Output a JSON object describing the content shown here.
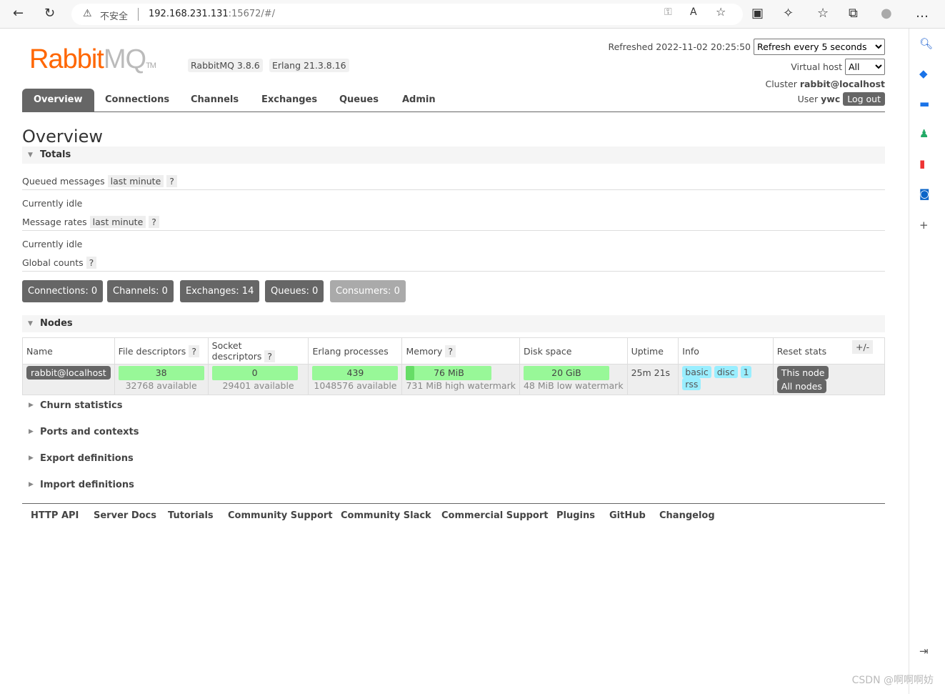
{
  "browser": {
    "insecure_label": "不安全",
    "url_host": "192.168.231.131",
    "url_rest": ":15672/#/"
  },
  "header": {
    "logo_text": "Rabbit",
    "logo_mq": "MQ",
    "logo_tm": "TM",
    "rabbitmq_version": "RabbitMQ 3.8.6",
    "erlang_version": "Erlang 21.3.8.16",
    "refreshed": "Refreshed 2022-11-02 20:25:50",
    "refresh_select": "Refresh every 5 seconds",
    "vhost_label": "Virtual host",
    "vhost_select": "All",
    "cluster_label": "Cluster",
    "cluster_value": "rabbit@localhost",
    "user_label": "User",
    "user_value": "ywc",
    "logout": "Log out"
  },
  "tabs": [
    "Overview",
    "Connections",
    "Channels",
    "Exchanges",
    "Queues",
    "Admin"
  ],
  "page_title": "Overview",
  "totals": {
    "title": "Totals",
    "queued_label": "Queued messages",
    "queued_range": "last minute",
    "help": "?",
    "idle1": "Currently idle",
    "rates_label": "Message rates",
    "rates_range": "last minute",
    "idle2": "Currently idle",
    "global_label": "Global counts"
  },
  "counts": [
    "Connections: 0",
    "Channels: 0",
    "Exchanges: 14",
    "Queues: 0",
    "Consumers: 0"
  ],
  "nodes": {
    "title": "Nodes",
    "headers": [
      "Name",
      "File descriptors",
      "Socket descriptors",
      "Erlang processes",
      "Memory",
      "Disk space",
      "Uptime",
      "Info",
      "Reset stats"
    ],
    "plusminus": "+/-",
    "row": {
      "name": "rabbit@localhost",
      "fd": "38",
      "fd_avail": "32768 available",
      "sd": "0",
      "sd_avail": "29401 available",
      "ep": "439",
      "ep_avail": "1048576 available",
      "mem": "76 MiB",
      "mem_sub": "731 MiB high watermark",
      "mem_fraction": 0.1,
      "disk": "20 GiB",
      "disk_sub": "48 MiB low watermark",
      "uptime": "25m 21s",
      "info": [
        "basic",
        "disc",
        "1",
        "rss"
      ],
      "reset_this": "This node",
      "reset_all": "All nodes"
    }
  },
  "collapsed": [
    "Churn statistics",
    "Ports and contexts",
    "Export definitions",
    "Import definitions"
  ],
  "footer": [
    "HTTP API",
    "Server Docs",
    "Tutorials",
    "Community Support",
    "Community Slack",
    "Commercial Support",
    "Plugins",
    "GitHub",
    "Changelog"
  ],
  "watermark": "CSDN @啊啊啊妨"
}
